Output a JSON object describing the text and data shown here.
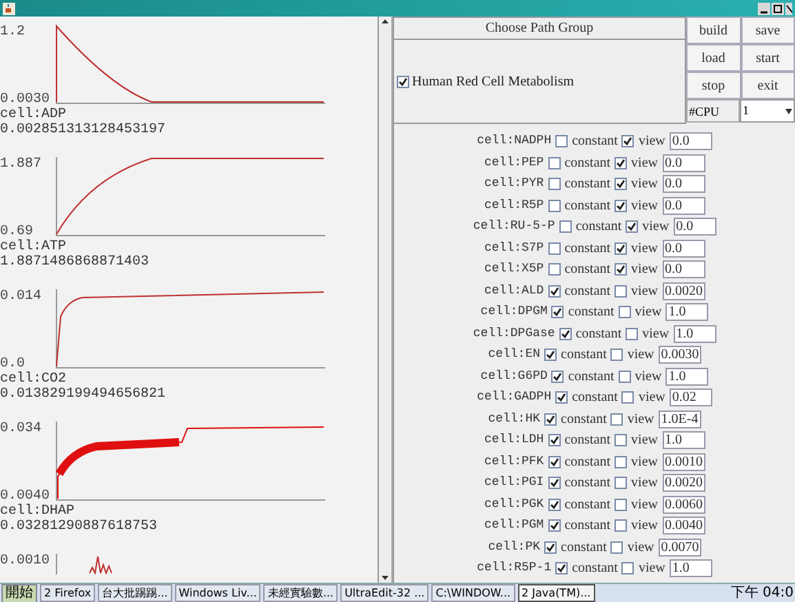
{
  "charts": [
    {
      "kind": "decay",
      "y_max": "1.2",
      "y_min": "0.0030",
      "name": "cell:ADP",
      "value": "0.002851313128453197"
    },
    {
      "kind": "rise",
      "y_max": "1.887",
      "y_min": "0.69",
      "name": "cell:ATP",
      "value": "1.8871486868871403"
    },
    {
      "kind": "saturate",
      "y_max": "0.014",
      "y_min": "0.0",
      "name": "cell:CO2",
      "value": "0.013829199494656821"
    },
    {
      "kind": "noisy",
      "y_max": "0.034",
      "y_min": "0.0040",
      "name": "cell:DHAP",
      "value": "0.03281290887618753"
    },
    {
      "kind": "spikes",
      "y_max": "0.0010"
    }
  ],
  "path_group": {
    "title": "Choose Path Group",
    "option": {
      "label": "Human Red Cell Metabolism",
      "checked": true
    }
  },
  "buttons": [
    "build",
    "save",
    "load",
    "start",
    "stop",
    "exit"
  ],
  "cpu": {
    "label": "#CPU",
    "value": "1"
  },
  "rows": [
    {
      "name": "cell:NADPH",
      "constant_label": "constant",
      "constant": false,
      "view_label": "view",
      "view": true,
      "value": "0.0"
    },
    {
      "name": "cell:PEP",
      "constant_label": "constant",
      "constant": false,
      "view_label": "view",
      "view": true,
      "value": "0.0"
    },
    {
      "name": "cell:PYR",
      "constant_label": "constant",
      "constant": false,
      "view_label": "view",
      "view": true,
      "value": "0.0"
    },
    {
      "name": "cell:R5P",
      "constant_label": "constant",
      "constant": false,
      "view_label": "view",
      "view": true,
      "value": "0.0"
    },
    {
      "name": "cell:RU-5-P",
      "constant_label": "constant",
      "constant": false,
      "view_label": "view",
      "view": true,
      "value": "0.0"
    },
    {
      "name": "cell:S7P",
      "constant_label": "constant",
      "constant": false,
      "view_label": "view",
      "view": true,
      "value": "0.0"
    },
    {
      "name": "cell:X5P",
      "constant_label": "constant",
      "constant": false,
      "view_label": "view",
      "view": true,
      "value": "0.0"
    },
    {
      "name": "cell:ALD",
      "constant_label": "constant",
      "constant": true,
      "view_label": "view",
      "view": false,
      "value": "0.0020"
    },
    {
      "name": "cell:DPGM",
      "constant_label": "constant",
      "constant": true,
      "view_label": "view",
      "view": false,
      "value": "1.0"
    },
    {
      "name": "cell:DPGase",
      "constant_label": "constant",
      "constant": true,
      "view_label": "view",
      "view": false,
      "value": "1.0"
    },
    {
      "name": "cell:EN",
      "constant_label": "constant",
      "constant": true,
      "view_label": "view",
      "view": false,
      "value": "0.0030"
    },
    {
      "name": "cell:G6PD",
      "constant_label": "constant",
      "constant": true,
      "view_label": "view",
      "view": false,
      "value": "1.0"
    },
    {
      "name": "cell:GADPH",
      "constant_label": "constant",
      "constant": true,
      "view_label": "view",
      "view": false,
      "value": "0.02"
    },
    {
      "name": "cell:HK",
      "constant_label": "constant",
      "constant": true,
      "view_label": "view",
      "view": false,
      "value": "1.0E-4"
    },
    {
      "name": "cell:LDH",
      "constant_label": "constant",
      "constant": true,
      "view_label": "view",
      "view": false,
      "value": "1.0"
    },
    {
      "name": "cell:PFK",
      "constant_label": "constant",
      "constant": true,
      "view_label": "view",
      "view": false,
      "value": "0.0010"
    },
    {
      "name": "cell:PGI",
      "constant_label": "constant",
      "constant": true,
      "view_label": "view",
      "view": false,
      "value": "0.0020"
    },
    {
      "name": "cell:PGK",
      "constant_label": "constant",
      "constant": true,
      "view_label": "view",
      "view": false,
      "value": "0.0060"
    },
    {
      "name": "cell:PGM",
      "constant_label": "constant",
      "constant": true,
      "view_label": "view",
      "view": false,
      "value": "0.0040"
    },
    {
      "name": "cell:PK",
      "constant_label": "constant",
      "constant": true,
      "view_label": "view",
      "view": false,
      "value": "0.0070"
    },
    {
      "name": "cell:R5P-1",
      "constant_label": "constant",
      "constant": true,
      "view_label": "view",
      "view": false,
      "value": "1.0"
    }
  ],
  "taskbar": {
    "start": "開始",
    "items": [
      {
        "label": "2 Firefox",
        "selected": false
      },
      {
        "label": "台大批踢踢...",
        "selected": false
      },
      {
        "label": "Windows Liv...",
        "selected": false
      },
      {
        "label": "未經實驗數...",
        "selected": false
      },
      {
        "label": "UltraEdit-32 ...",
        "selected": false
      },
      {
        "label": "C:\\WINDOW...",
        "selected": false
      },
      {
        "label": "2 Java(TM)...",
        "selected": true
      }
    ],
    "clock": "下午 04:0"
  }
}
